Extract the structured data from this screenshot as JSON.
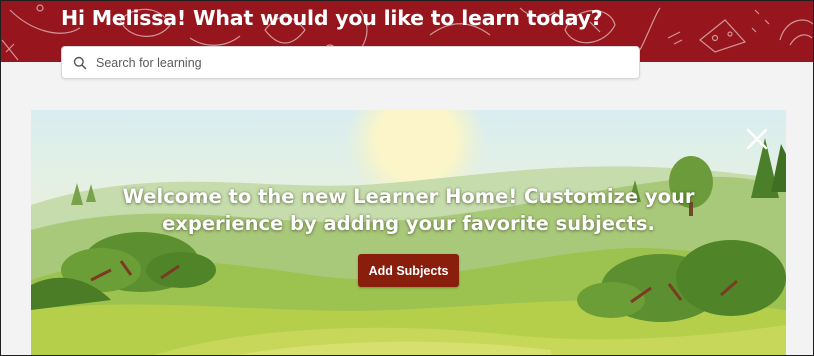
{
  "header": {
    "greeting": "Hi Melissa! What would you like to learn today?",
    "background_color": "#97151d"
  },
  "search": {
    "placeholder": "Search for learning",
    "value": ""
  },
  "banner": {
    "message_line1": "Welcome to the new Learner Home! Customize your",
    "message_line2": "experience by adding your favorite subjects.",
    "add_subjects_label": "Add Subjects",
    "button_color": "#8a1e0d",
    "close_icon": "close-icon"
  }
}
